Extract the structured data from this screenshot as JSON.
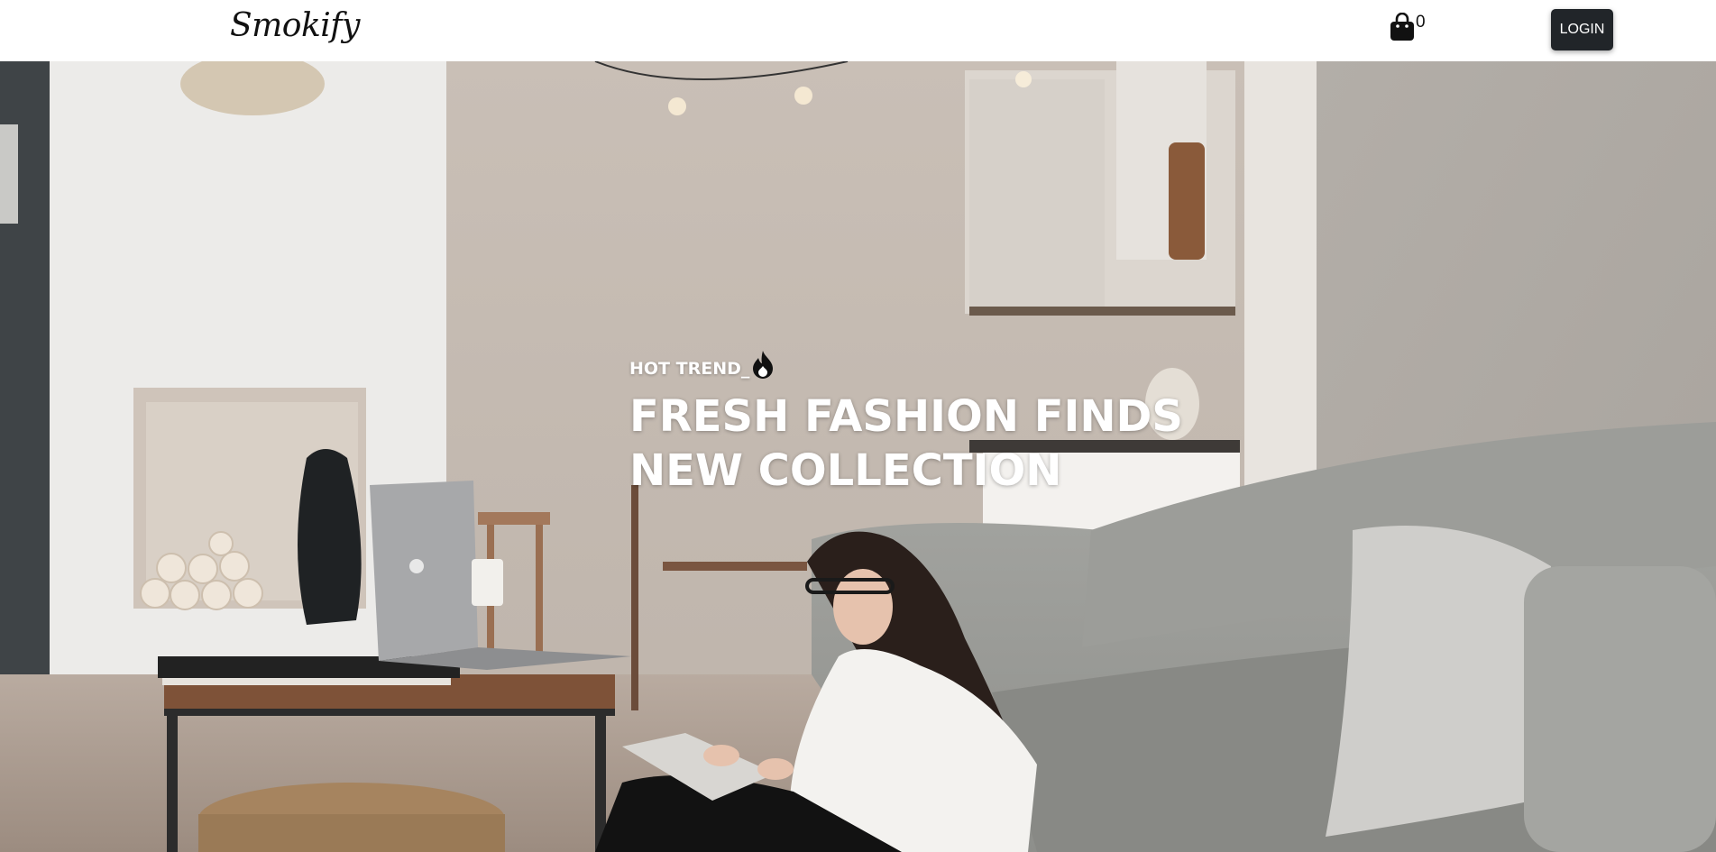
{
  "header": {
    "logo": "Smokify",
    "cart_count": "0",
    "login_label": "LOGIN"
  },
  "hero": {
    "kicker": "HOT TREND_",
    "headline_line1": "FRESH FASHION FINDS",
    "headline_line2": "NEW COLLECTION"
  },
  "icons": {
    "cart": "shopping-bag-icon",
    "kicker": "fire-icon"
  },
  "colors": {
    "login_bg": "#212529",
    "headline": "#ffffff"
  }
}
